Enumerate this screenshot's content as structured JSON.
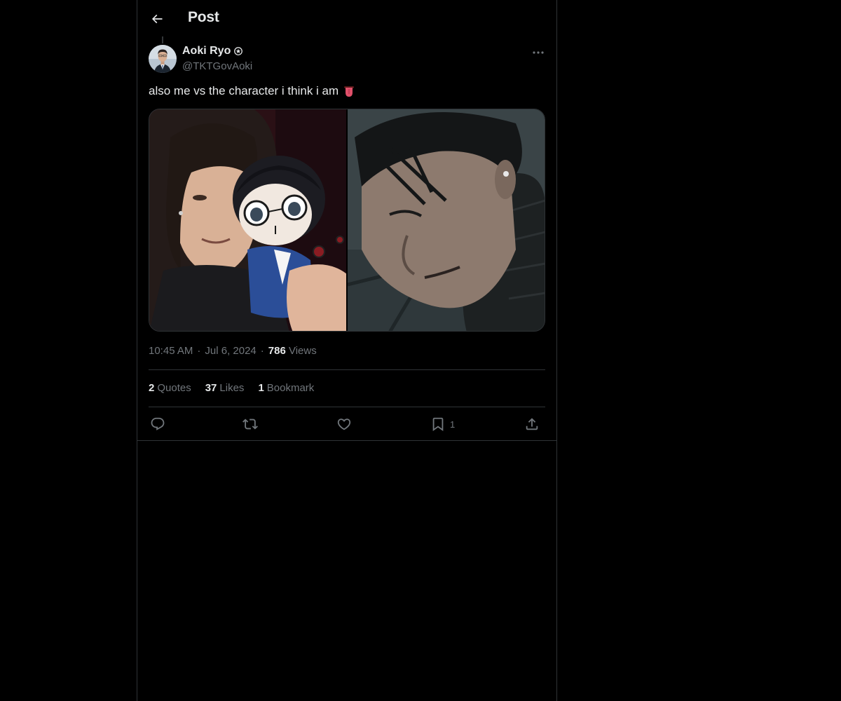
{
  "header": {
    "title": "Post"
  },
  "author": {
    "name": "Aoki Ryo",
    "handle": "@TKTGovAoki",
    "verified_icon": "verified-badge-icon"
  },
  "post": {
    "text": "also me vs the character i think i am",
    "emoji": "😛"
  },
  "meta": {
    "time": "10:45 AM",
    "separator": "·",
    "date": "Jul 6, 2024",
    "views_count": "786",
    "views_label": "Views"
  },
  "stats": {
    "quotes_count": "2",
    "quotes_label": "Quotes",
    "likes_count": "37",
    "likes_label": "Likes",
    "bookmarks_count": "1",
    "bookmarks_label": "Bookmark"
  },
  "actions": {
    "bookmark_count": "1"
  },
  "colors": {
    "background": "#000000",
    "text_primary": "#e7e9ea",
    "text_secondary": "#71767b",
    "border": "#2f3336"
  }
}
